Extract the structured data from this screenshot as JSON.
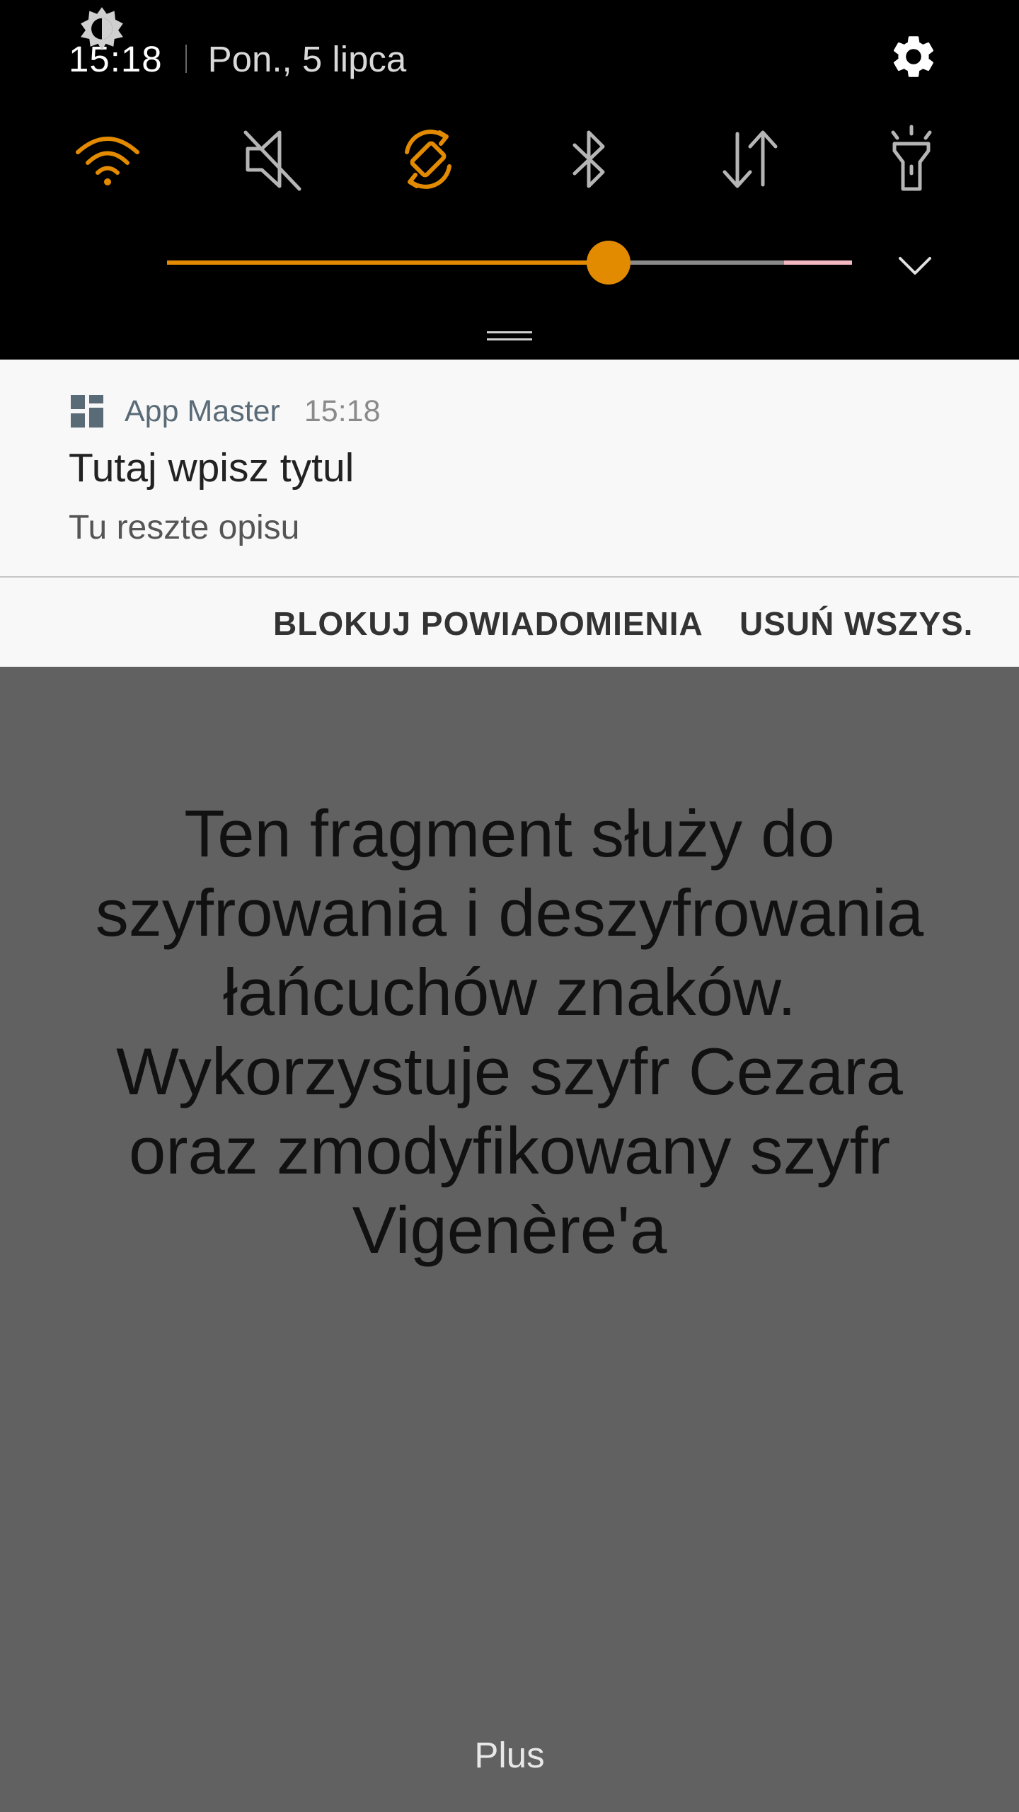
{
  "status": {
    "time": "15:18",
    "date": "Pon., 5 lipca"
  },
  "quick_settings": {
    "tiles": [
      {
        "icon": "wifi-icon",
        "active": true
      },
      {
        "icon": "sound-muted-icon",
        "active": false
      },
      {
        "icon": "auto-rotate-icon",
        "active": true
      },
      {
        "icon": "bluetooth-icon",
        "active": false
      },
      {
        "icon": "mobile-data-icon",
        "active": false
      },
      {
        "icon": "flashlight-icon",
        "active": false
      }
    ],
    "brightness_level": 0.645,
    "accent_color": "#e28a00"
  },
  "notification": {
    "app_name": "App Master",
    "time": "15:18",
    "title": "Tutaj wpisz tytul",
    "body": "Tu reszte opisu"
  },
  "actions": {
    "block": "BLOKUJ POWIADOMIENIA",
    "clear": "USUŃ WSZYS."
  },
  "app": {
    "description": "Ten fragment służy do szyfrowania i deszyfrowania łańcuchów znaków. Wykorzystuje szyfr Cezara oraz zmodyfikowany szyfr Vigenère'a",
    "plus_label": "Plus"
  }
}
